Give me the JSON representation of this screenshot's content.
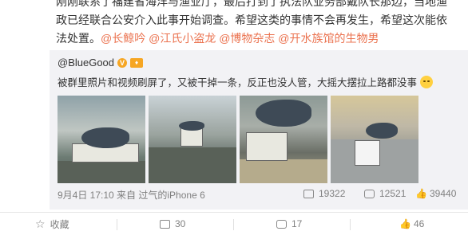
{
  "post": {
    "line1": "刚刚联系了福建省海洋与渔业厅，最后打到了执法队业务部戴队长那边，当地渔",
    "line2": "政已经联合公安介入此事开始调查。希望这类的事情不会再发生，希望这次能依",
    "line3_text": "法处置。",
    "tags": "@长鲸吟 @江氏小盗龙 @博物杂志 @开水族馆的生物男"
  },
  "repost": {
    "author": "@BlueGood",
    "text": "被群里照片和视频刷屏了，又被干掉一条，反正也没人管，大摇大摆拉上路都没事",
    "meta": "9月4日 17:10 来自 过气的iPhone 6",
    "shares": "19322",
    "comments": "12521",
    "likes": "39440"
  },
  "actions": {
    "collect": "收藏",
    "forward": "30",
    "comment": "17",
    "like": "46"
  }
}
